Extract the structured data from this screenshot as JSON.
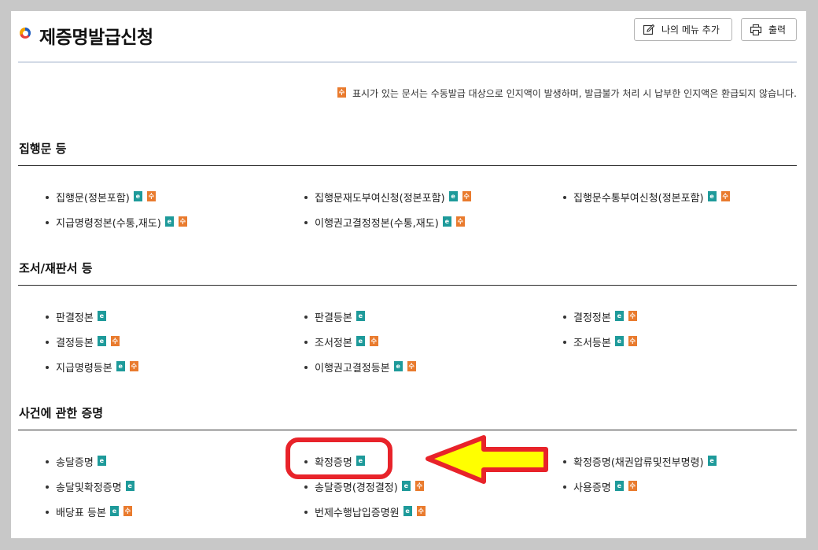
{
  "header": {
    "title": "제증명발급신청",
    "add_menu_label": "나의 메뉴 추가",
    "print_label": "출력"
  },
  "notice": {
    "badge": "수",
    "text": "표시가 있는 문서는 수동발급 대상으로 인지액이 발생하며, 발급불가 처리 시 납부한 인지액은 환급되지 않습니다."
  },
  "badges": {
    "electronic": "e",
    "manual": "수"
  },
  "sections": [
    {
      "title": "집행문 등",
      "items": [
        {
          "label": "집행문(정본포함)"
        },
        {
          "label": "집행문재도부여신청(정본포함)"
        },
        {
          "label": "집행문수통부여신청(정본포함)"
        },
        {
          "label": "지급명령정본(수통,재도)"
        },
        {
          "label": "이행권고결정정본(수통,재도)"
        }
      ]
    },
    {
      "title": "조서/재판서 등",
      "items": [
        {
          "label": "판결정본"
        },
        {
          "label": "판결등본"
        },
        {
          "label": "결정정본"
        },
        {
          "label": "결정등본"
        },
        {
          "label": "조서정본"
        },
        {
          "label": "조서등본"
        },
        {
          "label": "지급명령등본"
        },
        {
          "label": "이행권고결정등본"
        }
      ]
    },
    {
      "title": "사건에 관한 증명",
      "items": [
        {
          "label": "송달증명"
        },
        {
          "label": "확정증명"
        },
        {
          "label": "확정증명(채권압류및전부명령)"
        },
        {
          "label": "송달및확정증명"
        },
        {
          "label": "송달증명(경정결정)"
        },
        {
          "label": "사용증명"
        },
        {
          "label": "배당표 등본"
        },
        {
          "label": "번제수행납입증명원"
        }
      ]
    }
  ],
  "colors": {
    "electronic_badge": "#1e9a9a",
    "manual_badge": "#e97b2e",
    "highlight_box": "#e8232a",
    "arrow_fill": "#ffff00"
  }
}
